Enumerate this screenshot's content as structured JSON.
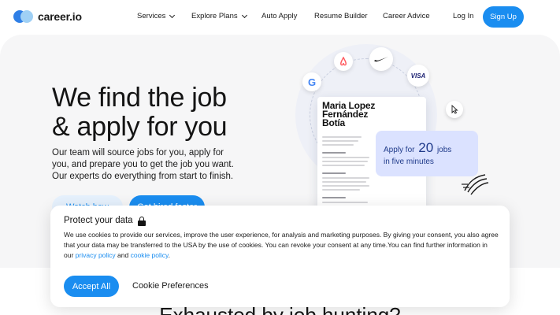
{
  "brand": {
    "name": "career.io",
    "colors": {
      "primary": "#1a8df0",
      "logo_dark": "#2f7fe6",
      "logo_light": "#9fd0f5"
    }
  },
  "nav": {
    "items": [
      {
        "label": "Services",
        "has_dropdown": true
      },
      {
        "label": "Explore Plans",
        "has_dropdown": true
      },
      {
        "label": "Auto Apply",
        "has_dropdown": false
      },
      {
        "label": "Resume Builder",
        "has_dropdown": false
      },
      {
        "label": "Career Advice",
        "has_dropdown": false
      }
    ],
    "login": "Log In",
    "signup": "Sign Up"
  },
  "hero": {
    "title_line1": "We find the job",
    "title_line2": "& apply for you",
    "description": "Our team will source jobs for you, apply for you, and prepare you to get the job you want. Our experts do everything from start to finish.",
    "watch_button": "Watch how",
    "hired_button": "Get hired faster",
    "illustration": {
      "brands": [
        "google-icon",
        "airbnb-icon",
        "nike-icon",
        "visa-icon"
      ],
      "resume_name": [
        "Maria Lopez",
        "Fernández",
        "Botía"
      ],
      "apply_prefix": "Apply for",
      "apply_number": "20",
      "apply_suffix": "jobs",
      "apply_line2": "in five minutes"
    }
  },
  "below": {
    "title": "Exhausted by job hunting?"
  },
  "cookie": {
    "title": "Protect your data",
    "text_before": "We use cookies to provide our services, improve the user experience, for analysis and marketing purposes. By giving your consent, you also agree that your data may be transferred to the USA by the use of cookies. You can revoke your consent at any time.You can find further information in our ",
    "privacy_link": "privacy policy",
    "and": " and ",
    "cookie_link": "cookie policy",
    "period": ".",
    "accept": "Accept All",
    "preferences": "Cookie Preferences"
  }
}
